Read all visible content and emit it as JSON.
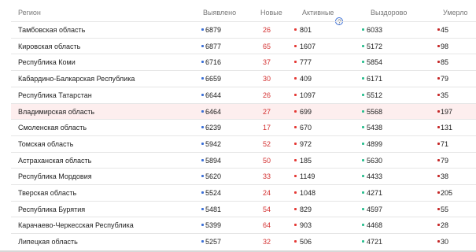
{
  "headers": {
    "region": "Регион",
    "detected": "Выявлено",
    "new": "Новые",
    "active": "Активные",
    "recovered": "Выздорово",
    "died": "Умерло"
  },
  "colors": {
    "detected_dot": "#3b6fd6",
    "new_text": "#d32f2f",
    "active_dot": "#e53935",
    "recovered_dot": "#2bbf8f",
    "died_dot": "#c62828",
    "highlight_row": "#fdeeee"
  },
  "highlighted_region": "Владимирская область",
  "rows": [
    {
      "region": "Тамбовская область",
      "detected": "6879",
      "new": "26",
      "active": "801",
      "recovered": "6033",
      "died": "45"
    },
    {
      "region": "Кировская область",
      "detected": "6877",
      "new": "65",
      "active": "1607",
      "recovered": "5172",
      "died": "98"
    },
    {
      "region": "Республика Коми",
      "detected": "6716",
      "new": "37",
      "active": "777",
      "recovered": "5854",
      "died": "85"
    },
    {
      "region": "Кабардино-Балкарская Республика",
      "detected": "6659",
      "new": "30",
      "active": "409",
      "recovered": "6171",
      "died": "79"
    },
    {
      "region": "Республика Татарстан",
      "detected": "6644",
      "new": "26",
      "active": "1097",
      "recovered": "5512",
      "died": "35"
    },
    {
      "region": "Владимирская область",
      "detected": "6464",
      "new": "27",
      "active": "699",
      "recovered": "5568",
      "died": "197"
    },
    {
      "region": "Смоленская область",
      "detected": "6239",
      "new": "17",
      "active": "670",
      "recovered": "5438",
      "died": "131"
    },
    {
      "region": "Томская область",
      "detected": "5942",
      "new": "52",
      "active": "972",
      "recovered": "4899",
      "died": "71"
    },
    {
      "region": "Астраханская область",
      "detected": "5894",
      "new": "50",
      "active": "185",
      "recovered": "5630",
      "died": "79"
    },
    {
      "region": "Республика Мордовия",
      "detected": "5620",
      "new": "33",
      "active": "1149",
      "recovered": "4433",
      "died": "38"
    },
    {
      "region": "Тверская область",
      "detected": "5524",
      "new": "24",
      "active": "1048",
      "recovered": "4271",
      "died": "205"
    },
    {
      "region": "Республика Бурятия",
      "detected": "5481",
      "new": "54",
      "active": "829",
      "recovered": "4597",
      "died": "55"
    },
    {
      "region": "Карачаево-Черкесская Республика",
      "detected": "5399",
      "new": "64",
      "active": "903",
      "recovered": "4468",
      "died": "28"
    },
    {
      "region": "Липецкая область",
      "detected": "5257",
      "new": "32",
      "active": "506",
      "recovered": "4721",
      "died": "30"
    }
  ]
}
